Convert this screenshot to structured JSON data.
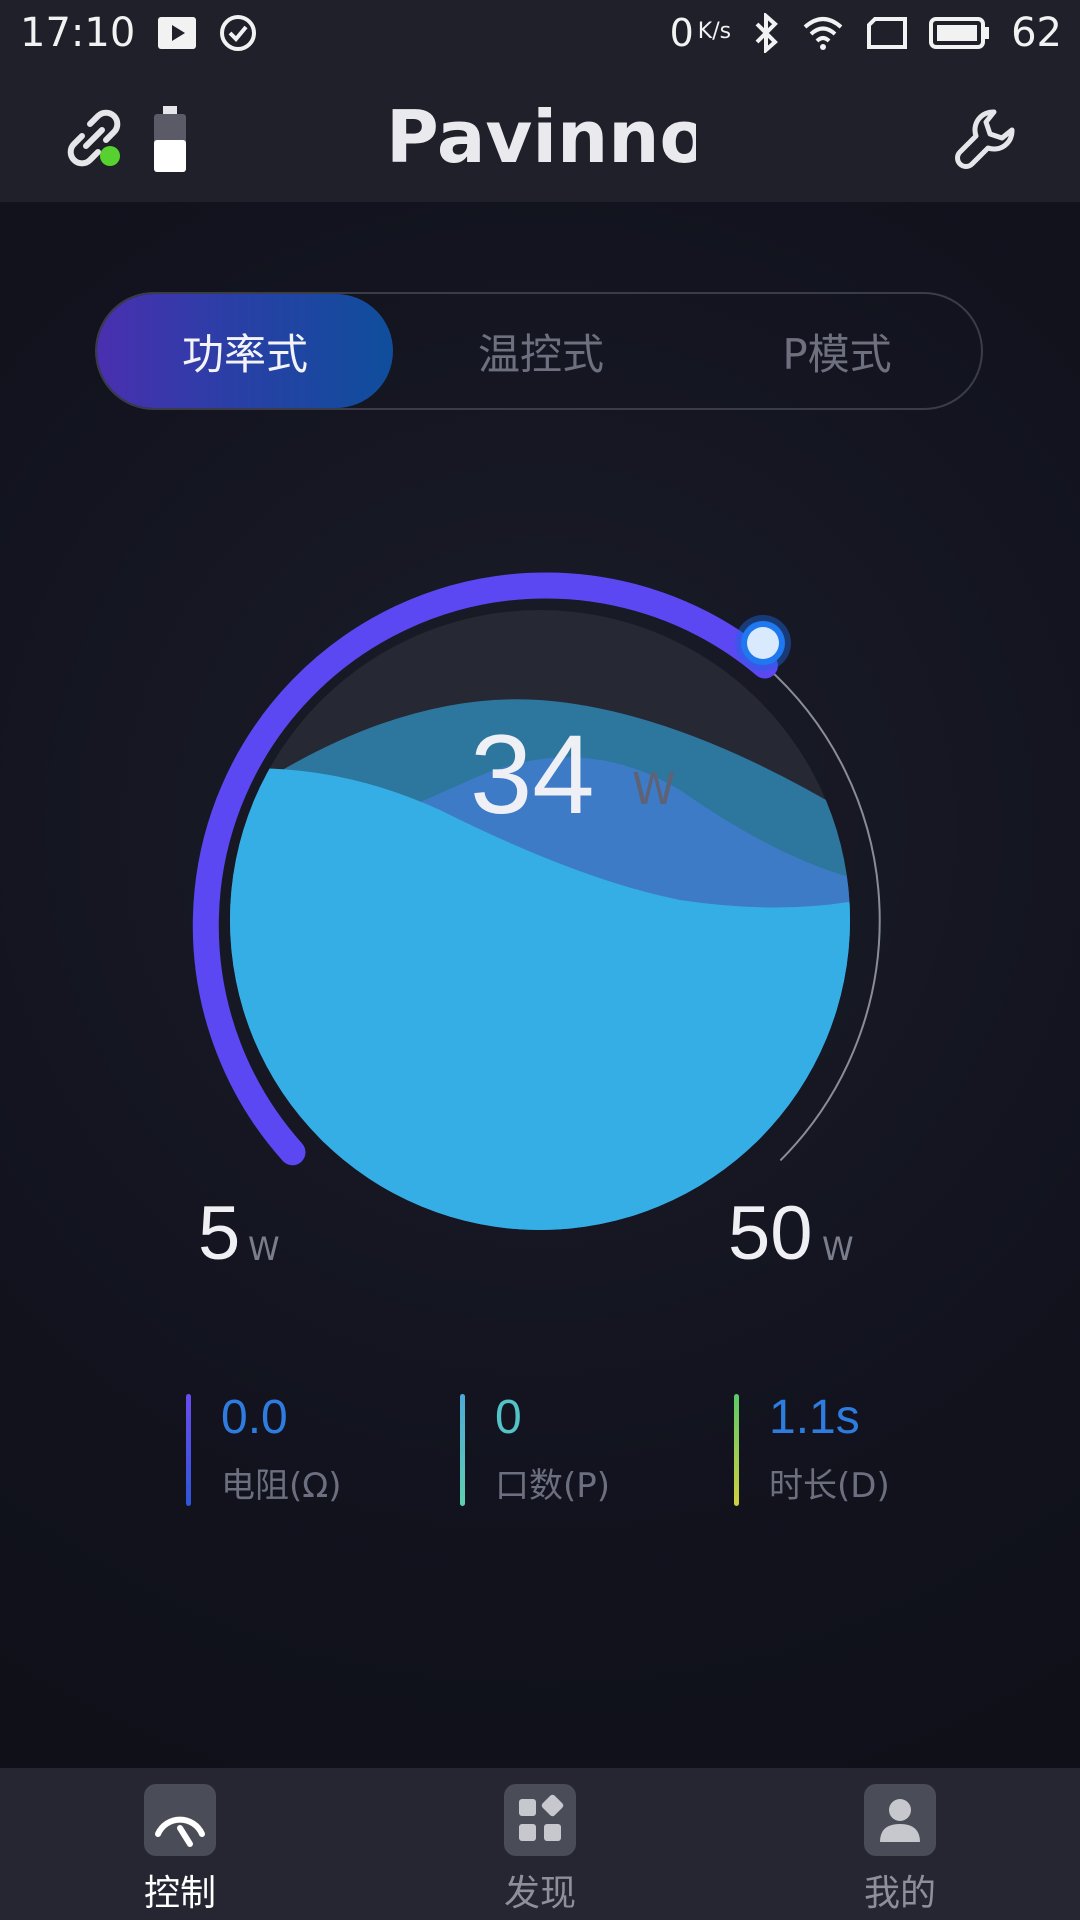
{
  "status_bar": {
    "time": "17:10",
    "net_speed": "0",
    "net_unit": "K/s",
    "battery_percent": "62"
  },
  "header": {
    "brand": "Pavinno"
  },
  "mode_tabs": [
    {
      "label": "功率式",
      "active": true
    },
    {
      "label": "温控式",
      "active": false
    },
    {
      "label": "P模式",
      "active": false
    }
  ],
  "dial": {
    "value": "34",
    "unit": "W",
    "min": "5",
    "min_unit": "W",
    "max": "50",
    "max_unit": "W",
    "level": 0.64
  },
  "metrics": [
    {
      "value": "0.0",
      "label": "电阻(Ω)",
      "color": "#2e7ce0"
    },
    {
      "value": "0",
      "label": "口数(P)",
      "color": "#53c3c8"
    },
    {
      "value": "1.1s",
      "label": "时长(D)",
      "color": "#2e7ce0"
    }
  ],
  "bottom_nav": [
    {
      "label": "控制",
      "icon": "gauge-icon",
      "active": true
    },
    {
      "label": "发现",
      "icon": "grid-icon",
      "active": false
    },
    {
      "label": "我的",
      "icon": "user-icon",
      "active": false
    }
  ],
  "colors": {
    "accent_purple": "#5b48f2",
    "water_blue": "#35aee6",
    "background": "#12131d"
  }
}
